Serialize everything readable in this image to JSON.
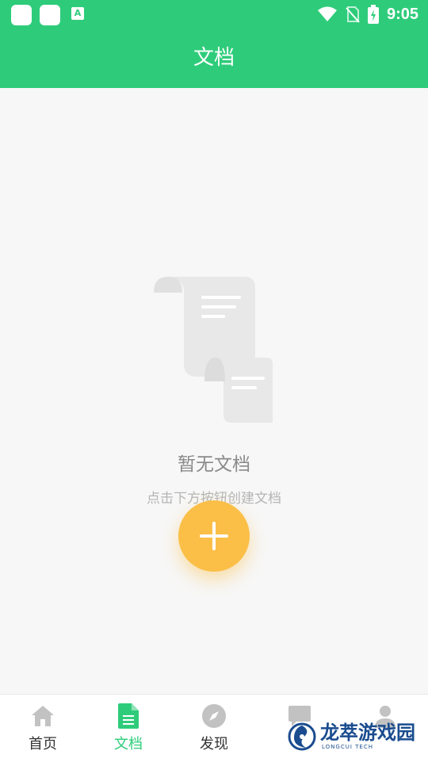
{
  "status_bar": {
    "time": "9:05",
    "app_badge_letter": "A"
  },
  "header": {
    "title": "文档"
  },
  "empty_state": {
    "title": "暂无文档",
    "subtitle": "点击下方按钮创建文档",
    "illustration_icon": "document-scroll-icon",
    "action_icon": "plus-icon"
  },
  "bottom_nav": {
    "items": [
      {
        "label": "首页",
        "icon": "home-icon",
        "active": false
      },
      {
        "label": "文档",
        "icon": "document-icon",
        "active": true
      },
      {
        "label": "发现",
        "icon": "compass-icon",
        "active": false
      },
      {
        "label": "",
        "icon": "chat-icon",
        "active": false
      },
      {
        "label": "",
        "icon": "user-icon",
        "active": false
      }
    ]
  },
  "watermark": {
    "title": "龙萃游戏园",
    "subtitle": "LONGCUI TECH"
  },
  "colors": {
    "primary": "#2ecc7a",
    "fab": "#fbbf48",
    "background": "#f7f7f7",
    "inactive_icon": "#c2c2c2"
  }
}
